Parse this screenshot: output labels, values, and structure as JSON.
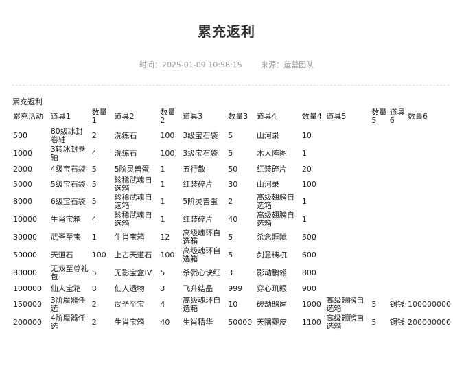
{
  "page": {
    "title": "累充返利",
    "time_label": "时间：",
    "time_value": "2025-01-09 10:58:15",
    "source_label": "来源：",
    "source_value": "运营团队"
  },
  "table": {
    "caption": "累充返利",
    "headers": [
      "累充活动",
      "道具1",
      "数量1",
      "道具2",
      "数量2",
      "道具3",
      "数量3",
      "道具4",
      "数量4",
      "道具5",
      "数量5",
      "道具6",
      "数量6"
    ],
    "rows": [
      [
        "500",
        "80级冰封卷轴",
        "2",
        "洗练石",
        "100",
        "3级宝石袋",
        "5",
        "山河录",
        "10",
        "",
        "",
        "",
        ""
      ],
      [
        "1000",
        "3转冰封卷轴",
        "4",
        "洗练石",
        "100",
        "3级宝石袋",
        "5",
        "木人阵图",
        "1",
        "",
        "",
        "",
        ""
      ],
      [
        "2000",
        "4级宝石袋",
        "5",
        "5阶灵兽蛋",
        "1",
        "五行散",
        "50",
        "红装碎片",
        "20",
        "",
        "",
        "",
        ""
      ],
      [
        "5000",
        "5级宝石袋",
        "5",
        "珍稀武魂自选箱",
        "1",
        "红装碎片",
        "30",
        "山河录",
        "100",
        "",
        "",
        "",
        ""
      ],
      [
        "8000",
        "6级宝石袋",
        "5",
        "珍稀武魂自选箱",
        "1",
        "5阶灵兽蛋",
        "2",
        "高级翅膀自选箱",
        "1",
        "",
        "",
        "",
        ""
      ],
      [
        "10000",
        "生肖宝箱",
        "4",
        "珍稀武魂自选箱",
        "1",
        "红装碎片",
        "40",
        "高级翅膀自选箱",
        "1",
        "",
        "",
        "",
        ""
      ],
      [
        "30000",
        "武圣至宝",
        "1",
        "生肖宝箱",
        "12",
        "高级魂环自选箱",
        "5",
        "杀念睚眦",
        "500",
        "",
        "",
        "",
        ""
      ],
      [
        "50000",
        "天道石",
        "100",
        "上古天道石",
        "100",
        "高级魂环自选箱",
        "5",
        "剑意梼杌",
        "600",
        "",
        "",
        "",
        ""
      ],
      [
        "80000",
        "无双至尊礼包",
        "5",
        "无影宝盒IV",
        "5",
        "杀戮心诀红",
        "3",
        "影动鹏翎",
        "800",
        "",
        "",
        "",
        ""
      ],
      [
        "100000",
        "仙人宝箱",
        "8",
        "仙人遗物",
        "3",
        "飞升结晶",
        "999",
        "穿心玑眼",
        "900",
        "",
        "",
        "",
        ""
      ],
      [
        "150000",
        "3阶魔器任选",
        "2",
        "武圣至宝",
        "4",
        "高级魂环自选箱",
        "10",
        "破劫鸱尾",
        "1000",
        "高级翅膀自选箱",
        "5",
        "铜钱",
        "100000000"
      ],
      [
        "200000",
        "4阶魔器任选",
        "2",
        "生肖宝箱",
        "40",
        "生肖精华",
        "50000",
        "天隅虁皮",
        "1100",
        "高级翅膀自选箱",
        "5",
        "铜钱",
        "200000000"
      ]
    ]
  }
}
